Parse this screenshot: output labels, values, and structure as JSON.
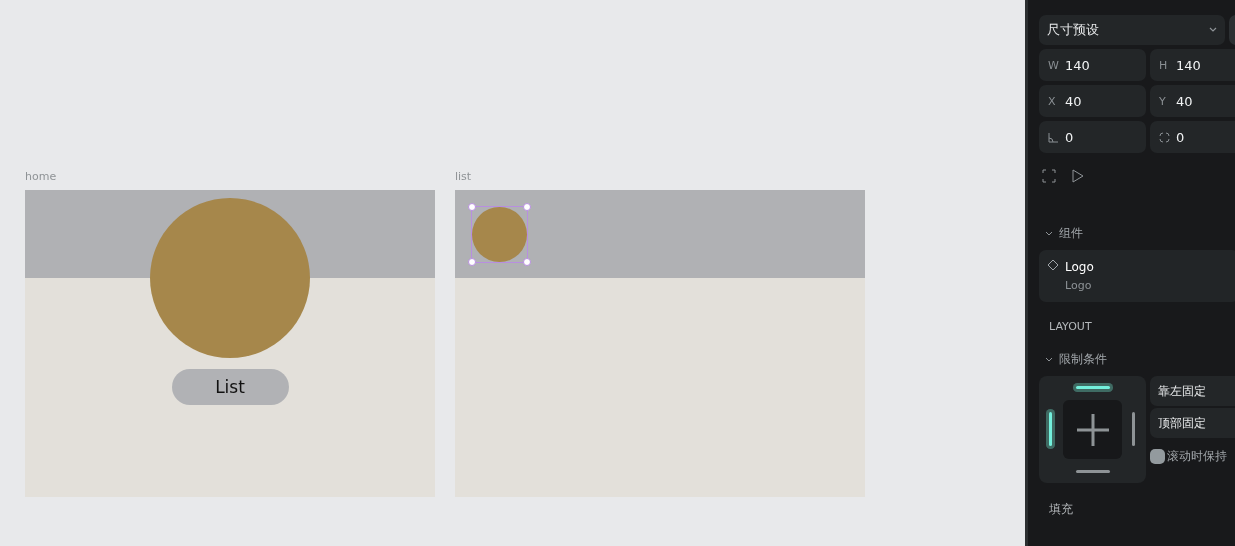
{
  "frames": [
    {
      "label": "home",
      "kind": "hero",
      "button": "List",
      "logo_selected": false
    },
    {
      "label": "list",
      "kind": "compact",
      "logo_selected": true
    }
  ],
  "panel": {
    "preset": "尺寸预设",
    "fields": [
      {
        "kind": "w",
        "label": "W",
        "value": "140"
      },
      {
        "kind": "h",
        "label": "H",
        "value": "140"
      },
      {
        "kind": "x",
        "label": "X",
        "value": "40"
      },
      {
        "kind": "y",
        "label": "Y",
        "value": "40"
      },
      {
        "kind": "angle",
        "value": "0"
      },
      {
        "kind": "radius",
        "value": "0"
      }
    ],
    "component_section": {
      "title": "组件",
      "expanded": true,
      "name": "Logo",
      "subtitle": "Logo"
    },
    "layout_title": "LAYOUT",
    "constraints": {
      "title": "限制条件",
      "expanded": true,
      "top": true,
      "left": true,
      "right": false,
      "bottom": false,
      "horizontal": "靠左固定",
      "vertical": "顶部固定",
      "scroll_fixed": {
        "label": "滚动时保持",
        "checked": false
      }
    },
    "fill_title": "填充"
  }
}
